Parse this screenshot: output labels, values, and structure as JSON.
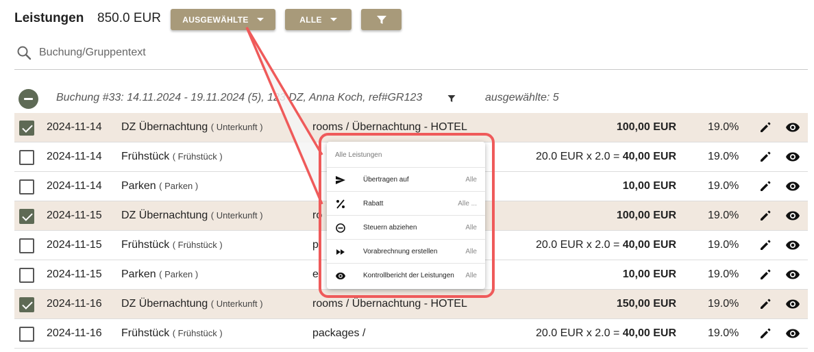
{
  "header": {
    "title": "Leistungen",
    "total": "850.0 EUR",
    "selected_button_label": "AUSGEWÄHLTE",
    "all_button_label": "ALLE",
    "filter_icon": "filter-icon"
  },
  "search": {
    "placeholder": "Buchung/Gruppentext",
    "value": ""
  },
  "group": {
    "label": "Buchung #33: 14.11.2024 - 19.11.2024 (5), 123 DZ, Anna Koch, ref#GR123",
    "selected_count_label": "ausgewählte: 5"
  },
  "rows": [
    {
      "selected": true,
      "date": "2024-11-14",
      "name": "DZ Übernachtung",
      "category": "( Unterkunft )",
      "description": "rooms / Übernachtung - HOTEL",
      "price_prefix": "",
      "price": "100,00 EUR",
      "vat": "19.0%"
    },
    {
      "selected": false,
      "date": "2024-11-14",
      "name": "Frühstück",
      "category": "( Frühstück )",
      "description": "",
      "price_prefix": "20.0 EUR x 2.0 = ",
      "price": "40,00 EUR",
      "vat": "19.0%"
    },
    {
      "selected": false,
      "date": "2024-11-14",
      "name": "Parken",
      "category": "( Parken )",
      "description": "",
      "price_prefix": "",
      "price": "10,00 EUR",
      "vat": "19.0%"
    },
    {
      "selected": true,
      "date": "2024-11-15",
      "name": "DZ Übernachtung",
      "category": "( Unterkunft )",
      "description": "ro",
      "price_prefix": "",
      "price": "100,00 EUR",
      "vat": "19.0%"
    },
    {
      "selected": false,
      "date": "2024-11-15",
      "name": "Frühstück",
      "category": "( Frühstück )",
      "description": "p",
      "price_prefix": "20.0 EUR x 2.0 = ",
      "price": "40,00 EUR",
      "vat": "19.0%"
    },
    {
      "selected": false,
      "date": "2024-11-15",
      "name": "Parken",
      "category": "( Parken )",
      "description": "e",
      "price_prefix": "",
      "price": "10,00 EUR",
      "vat": "19.0%"
    },
    {
      "selected": true,
      "date": "2024-11-16",
      "name": "DZ Übernachtung",
      "category": "( Unterkunft )",
      "description": "rooms / Übernachtung - HOTEL",
      "price_prefix": "",
      "price": "150,00 EUR",
      "vat": "19.0%"
    },
    {
      "selected": false,
      "date": "2024-11-16",
      "name": "Frühstück",
      "category": "( Frühstück )",
      "description": "packages /",
      "price_prefix": "20.0 EUR x 2.0 = ",
      "price": "40,00 EUR",
      "vat": "19.0%"
    }
  ],
  "popup": {
    "heading": "Alle Leistungen",
    "items": [
      {
        "icon": "send-icon",
        "label": "Übertragen auf",
        "scope": "Alle"
      },
      {
        "icon": "percent-icon",
        "label": "Rabatt",
        "scope": "Alle ..."
      },
      {
        "icon": "minus-circle-icon",
        "label": "Steuern abziehen",
        "scope": "Alle"
      },
      {
        "icon": "fast-forward-icon",
        "label": "Vorabrechnung erstellen",
        "scope": "Alle"
      },
      {
        "icon": "eye-icon",
        "label": "Kontrollbericht der Leistungen",
        "scope": "Alle"
      }
    ]
  },
  "colors": {
    "button_bg": "#a89a7a",
    "selected_row_bg": "#f1e8df",
    "checkbox_checked": "#5e6a55",
    "callout_red": "#ef5a5a"
  }
}
